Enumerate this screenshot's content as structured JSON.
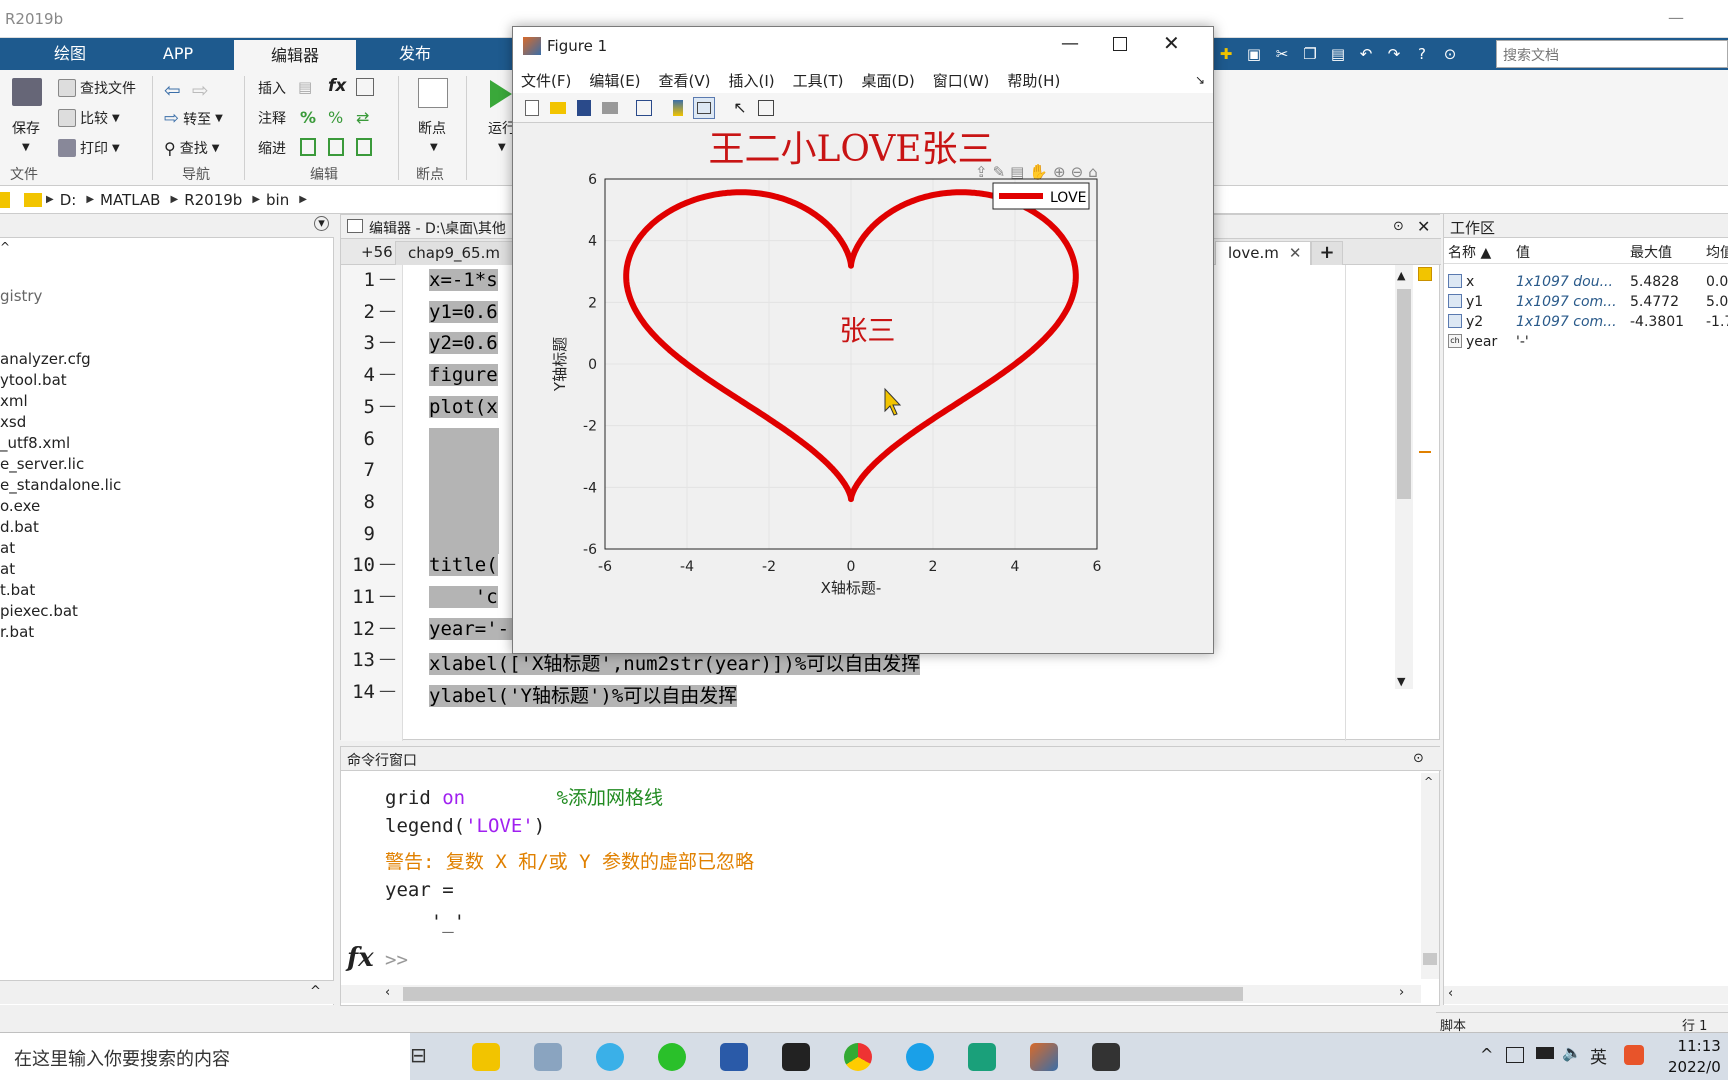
{
  "titlebar": {
    "title": "R2019b",
    "minimize": "—"
  },
  "ribbon_tabs": [
    {
      "label": "绘图"
    },
    {
      "label": "APP"
    },
    {
      "label": "编辑器"
    },
    {
      "label": "发布"
    }
  ],
  "search_docs_placeholder": "搜索文档",
  "ribbon": {
    "file": {
      "save": "保存",
      "find_files": "查找文件",
      "compare": "比较",
      "print": "打印",
      "group": "文件"
    },
    "nav": {
      "goto": "转至",
      "find": "查找",
      "group": "导航"
    },
    "edit": {
      "insert": "插入",
      "comment": "注释",
      "indent": "缩进",
      "fx": "fx",
      "group": "编辑"
    },
    "breakpoints": {
      "label": "断点",
      "group": "断点"
    },
    "run": {
      "label": "运行"
    }
  },
  "address": {
    "crumbs": [
      "D:",
      "MATLAB",
      "R2019b",
      "bin"
    ]
  },
  "files": [
    "gistry",
    "",
    "",
    "analyzer.cfg",
    "ytool.bat",
    "xml",
    "xsd",
    "_utf8.xml",
    "e_server.lic",
    "e_standalone.lic",
    "o.exe",
    "d.bat",
    "at",
    "at",
    "t.bat",
    "piexec.bat",
    "r.bat"
  ],
  "editor": {
    "title": "编辑器 - D:\\桌面\\其他",
    "tabs": [
      {
        "label": "+56"
      },
      {
        "label": "chap9_65.m"
      },
      {
        "label": "love.m"
      },
      {
        "label": "+"
      }
    ],
    "lines": [
      {
        "n": "1",
        "code": "x=-1*s"
      },
      {
        "n": "2",
        "code": "y1=0.6"
      },
      {
        "n": "3",
        "code": "y2=0.6"
      },
      {
        "n": "4",
        "code": "figure"
      },
      {
        "n": "5",
        "code": "plot(x"
      },
      {
        "n": "6",
        "code": ""
      },
      {
        "n": "7",
        "code": ""
      },
      {
        "n": "8",
        "code": ""
      },
      {
        "n": "9",
        "code": ""
      },
      {
        "n": "10",
        "code": "title("
      },
      {
        "n": "11",
        "code": "    'c"
      },
      {
        "n": "12",
        "code": "year='-'"
      },
      {
        "n": "13",
        "code": "xlabel(['X轴标题',num2str(year)])%可以自由发挥"
      },
      {
        "n": "14",
        "code": "ylabel('Y轴标题')%可以自由发挥"
      }
    ]
  },
  "command": {
    "title": "命令行窗口",
    "lines": [
      {
        "text": "grid ",
        "kw": "on",
        "comment": "        %添加网格线"
      },
      {
        "text": "legend(",
        "str": "'LOVE'",
        "tail": ")"
      },
      {
        "warn": "警告: 复数 X 和/或 Y 参数的虚部已忽略"
      },
      {
        "text": "year ="
      },
      {
        "text": "    '_'"
      }
    ],
    "prompt": ">>",
    "fx": "fx"
  },
  "workspace": {
    "title": "工作区",
    "headers": [
      "名称 ▲",
      "值",
      "最大值",
      "均值"
    ],
    "rows": [
      {
        "name": "x",
        "value": "1x1097 dou...",
        "max": "5.4828",
        "mean": "0.00"
      },
      {
        "name": "y1",
        "value": "1x1097 com...",
        "max": "5.4772",
        "mean": "5.0"
      },
      {
        "name": "y2",
        "value": "1x1097 com...",
        "max": "-4.3801",
        "mean": "-1.7"
      },
      {
        "name": "year",
        "value": "'-'",
        "max": "",
        "mean": ""
      }
    ]
  },
  "statusbar": {
    "script": "脚本",
    "row": "行 1"
  },
  "figure": {
    "title": "Figure 1",
    "menus": [
      "文件(F)",
      "编辑(E)",
      "查看(V)",
      "插入(I)",
      "工具(T)",
      "桌面(D)",
      "窗口(W)",
      "帮助(H)"
    ]
  },
  "chart_data": {
    "type": "line",
    "title": "王二小LOVE张三",
    "xlabel": "X轴标题-",
    "ylabel": "Y轴标题",
    "xlim": [
      -6,
      6
    ],
    "ylim": [
      -6,
      6
    ],
    "xticks": [
      -6,
      -4,
      -2,
      0,
      2,
      4,
      6
    ],
    "yticks": [
      -6,
      -4,
      -2,
      0,
      2,
      4,
      6
    ],
    "grid": true,
    "legend": "top-right",
    "series": [
      {
        "name": "LOVE",
        "color": "#e00000",
        "curve": "heart",
        "x_max": 5.4828,
        "y_max": 5.4772,
        "y_min": -4.3801
      }
    ],
    "annotations": [
      {
        "text": "张三",
        "x": 0.4,
        "y": 1.1
      }
    ]
  },
  "taskbar": {
    "search": "在这里输入你要搜索的内容",
    "time": "11:13",
    "date": "2022/0",
    "ime": "英"
  },
  "colors": {
    "accent": "#1e5a8e",
    "heart": "#e00000",
    "title": "#c81414",
    "warning": "#e08000",
    "keyword": "#a020f0",
    "comment": "#228b22"
  }
}
